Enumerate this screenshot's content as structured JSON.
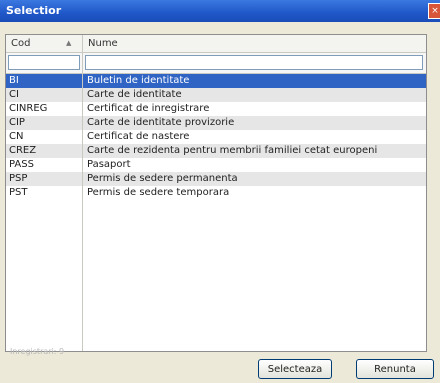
{
  "window": {
    "title": "Selectior",
    "close_glyph": "×"
  },
  "table": {
    "columns": [
      "Cod",
      "Nume"
    ],
    "filters": {
      "cod": "",
      "nume": ""
    },
    "rows": [
      {
        "cod": "BI",
        "nume": "Buletin de identitate"
      },
      {
        "cod": "CI",
        "nume": "Carte de identitate"
      },
      {
        "cod": "CINREG",
        "nume": "Certificat de inregistrare"
      },
      {
        "cod": "CIP",
        "nume": "Carte de identitate provizorie"
      },
      {
        "cod": "CN",
        "nume": "Certificat de nastere"
      },
      {
        "cod": "CREZ",
        "nume": "Carte de rezidenta pentru membrii familiei cetat europeni"
      },
      {
        "cod": "PASS",
        "nume": "Pasaport"
      },
      {
        "cod": "PSP",
        "nume": "Permis de sedere permanenta"
      },
      {
        "cod": "PST",
        "nume": "Permis de sedere temporara"
      }
    ]
  },
  "status": "Inregistrari: 9",
  "buttons": {
    "select": "Selecteaza",
    "cancel": "Renunta"
  },
  "icons": {
    "sort_indicator": "sort-ascending-icon",
    "close": "close-icon"
  },
  "colors": {
    "titlebar": "#1f57c8",
    "selected_row": "#2f63c4",
    "alt_row": "#e6e6e6"
  }
}
